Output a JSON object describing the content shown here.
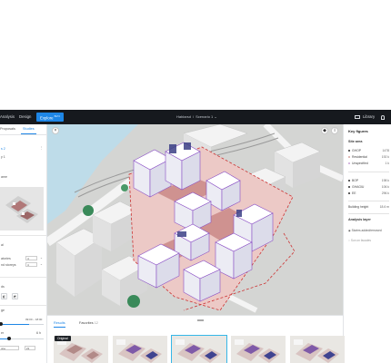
{
  "topbar": {
    "nav": [
      "Analysis",
      "Design",
      "Explore"
    ],
    "explore_badge": "BETA",
    "breadcrumb": [
      "Hablarsd",
      "Scenario 1"
    ],
    "library_label": "Library"
  },
  "left_panel": {
    "tabs": [
      "Proposals",
      "Studies"
    ],
    "item_title": "s 2",
    "item_sub": "y 1",
    "item_sub2": "ame",
    "row_lables": [
      "al",
      "atories",
      "nd storeys"
    ],
    "row_values": [
      "4",
      "4"
    ],
    "section_labels": [
      "ds",
      "ge"
    ],
    "slider_range": "09:00 – 18:00",
    "slider2_label": "er",
    "slider2_value": "6 h",
    "select_value": "une",
    "select_day": "21",
    "colors": {
      "accent": "#1e86e6"
    }
  },
  "map": {
    "controls": [
      "close",
      "compass",
      "info"
    ]
  },
  "right_panel": {
    "title": "Key figures",
    "site_area_title": "Site area",
    "rows_a": [
      {
        "label": "GHOP",
        "value": "1478",
        "color": "#2a2a2a"
      },
      {
        "label": "Residential",
        "value": "192 k",
        "color": "#d6a19c"
      },
      {
        "label": "Unspecified",
        "value": "1 k",
        "color": "#c8a2d6"
      }
    ],
    "rows_b": [
      {
        "label": "BOP",
        "value": "198 k",
        "color": "#2a2a2a"
      },
      {
        "label": "GHAGIU",
        "value": "106 k",
        "color": "#2a2a2a"
      },
      {
        "label": "EE",
        "value": "296 k",
        "color": "#2a2a2a"
      }
    ],
    "building_height_label": "Building height",
    "building_height_value": "18.6 m",
    "analysis_title": "Analysis layer",
    "analysis_items": [
      "Stories added/removed",
      "Sun on facades"
    ]
  },
  "bottom_panel": {
    "tabs": [
      "Results",
      "Favorites"
    ],
    "favorites_count": "12",
    "tooltip": "Original",
    "thumbnail_count": 5
  }
}
